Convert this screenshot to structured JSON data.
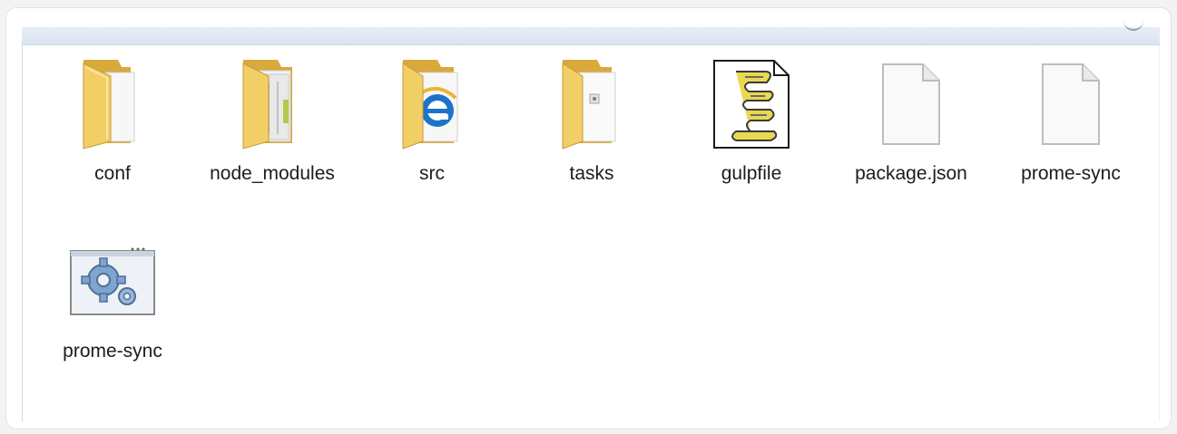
{
  "items": [
    {
      "label": "conf",
      "icon": "folder-icon"
    },
    {
      "label": "node_modules",
      "icon": "folder-icon"
    },
    {
      "label": "src",
      "icon": "folder-ie-icon"
    },
    {
      "label": "tasks",
      "icon": "folder-icon"
    },
    {
      "label": "gulpfile",
      "icon": "script-icon"
    },
    {
      "label": "package.json",
      "icon": "file-icon"
    },
    {
      "label": "prome-sync",
      "icon": "file-icon"
    },
    {
      "label": "prome-sync",
      "icon": "gear-icon"
    }
  ],
  "colors": {
    "folder": "#f2cf66",
    "folder_dark": "#d9a93b",
    "ie_blue": "#1b74c9",
    "script_yellow": "#e8d94f"
  }
}
